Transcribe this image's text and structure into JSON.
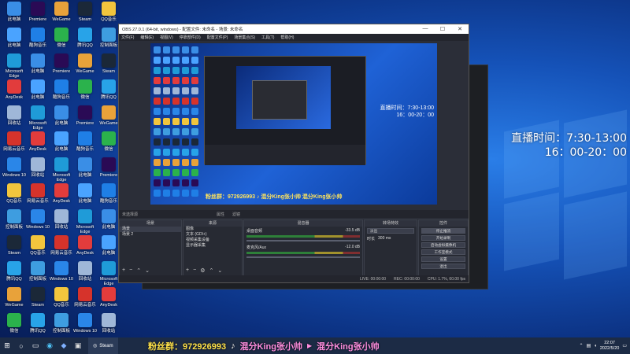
{
  "desktop": {
    "overlay": {
      "line1": "直播时间：7:30-13:00",
      "line2": "16：00-20：00"
    },
    "icons": [
      {
        "label": "此电脑",
        "color": "#3a8ee6"
      },
      {
        "label": "此电脑",
        "color": "#4aa3ff"
      },
      {
        "label": "Microsoft Edge",
        "color": "#1f9bd8"
      },
      {
        "label": "AnyDesk",
        "color": "#e23c3c"
      },
      {
        "label": "回收站",
        "color": "#9fb7d8"
      },
      {
        "label": "网易云音乐",
        "color": "#d6332b"
      },
      {
        "label": "Windows 10",
        "color": "#2a86e8"
      },
      {
        "label": "QQ音乐",
        "color": "#f2c53d"
      },
      {
        "label": "控制面板",
        "color": "#3e9de0"
      },
      {
        "label": "Steam",
        "color": "#1b2838"
      },
      {
        "label": "腾讯QQ",
        "color": "#28a3e8"
      },
      {
        "label": "WeGame",
        "color": "#e8a23a"
      },
      {
        "label": "微信",
        "color": "#2bb24c"
      },
      {
        "label": "Premiere",
        "color": "#2a0a55"
      },
      {
        "label": "酷狗音乐",
        "color": "#1f7fe6"
      }
    ]
  },
  "obs": {
    "title": "OBS 27.0.1 (64-bit, windows) - 配置文件: 未命名 - 场景: 未命名",
    "menus": [
      "文件(F)",
      "编辑(E)",
      "视图(V)",
      "停靠部件(D)",
      "配置文件(P)",
      "场景集合(S)",
      "工具(T)",
      "帮助(H)"
    ],
    "preview_overlay": {
      "line1": "直播时间：7:30-13:00",
      "line2": "16：00-20：00"
    },
    "preview_banner": "粉丝群：972926993 ♪ 混分King张小帅 混分King张小帅",
    "status_strip": {
      "label": "未选择源",
      "properties": "属性",
      "filters": "滤镜"
    },
    "docks": {
      "scenes": {
        "title": "场景",
        "items": [
          "场景",
          "场景 2"
        ]
      },
      "sources": {
        "title": "来源",
        "items": [
          "图像",
          "文本 (GDI+)",
          "视频采集设备",
          "显示器采集"
        ]
      },
      "mixer": {
        "title": "混音器",
        "tracks": [
          {
            "name": "桌面音频",
            "db": "-33.5 dB"
          },
          {
            "name": "麦克风/Aux",
            "db": "-12.0 dB"
          }
        ]
      },
      "transitions": {
        "title": "转场特效",
        "type": "淡出",
        "duration_label": "时长",
        "duration": "300 ms"
      },
      "controls": {
        "title": "控件",
        "buttons": [
          "停止推流",
          "开始录制",
          "启动虚拟摄像机",
          "工作室模式",
          "设置",
          "退出"
        ]
      }
    },
    "statusbar": {
      "live": "LIVE: 00:00:00",
      "rec": "REC: 00:00:00",
      "cpu": "CPU: 1.7%, 60.00 fps"
    }
  },
  "taskbar": {
    "steam_label": "Steam",
    "banner": {
      "group": "粉丝群：972926993",
      "name1": "混分King张小帅",
      "name2": "混分King张小帅"
    },
    "clock": {
      "time": "22:07",
      "date": "2022/5/20"
    }
  }
}
